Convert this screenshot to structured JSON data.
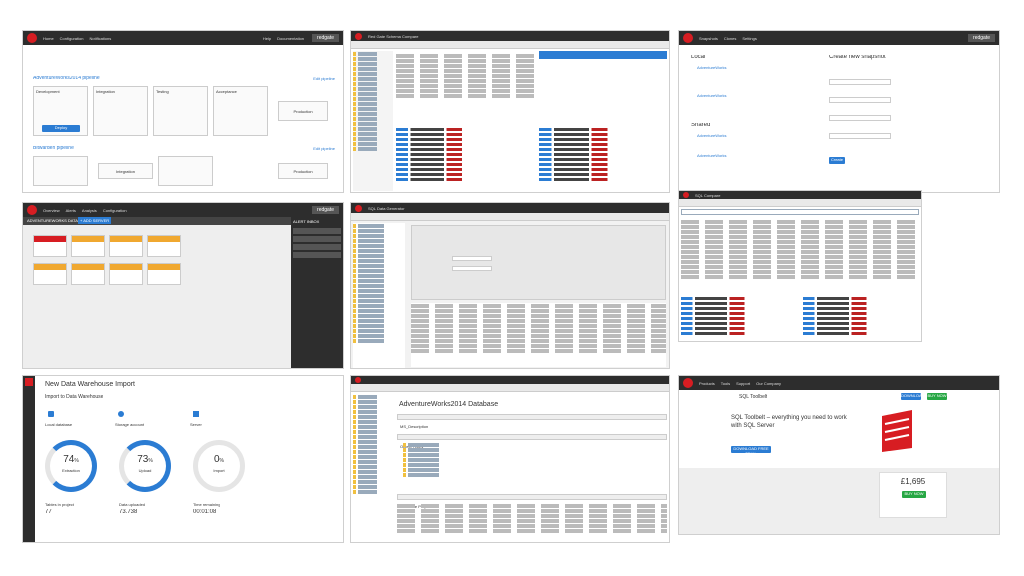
{
  "tiles": {
    "tile1": {
      "nav": [
        "Home",
        "Configuration",
        "Notifications"
      ],
      "header_right": [
        "Help",
        "Documentation"
      ],
      "brand": "redgate",
      "pipeline1_title": "AdventureWorks2014 pipeline",
      "pipeline2_title": "Bitwarden pipeline",
      "stages": [
        "Development",
        "Integration",
        "Testing",
        "Acceptance",
        "Production"
      ],
      "edit_link": "Edit pipeline",
      "deploy_label": "Deploy",
      "production_label": "Production",
      "integration_label": "Integration"
    },
    "tile2": {
      "tabs": [
        "Search",
        "Schema Compare"
      ],
      "title": "Red Gate Schema Compare",
      "brand": "redgate"
    },
    "tile3": {
      "nav": [
        "Snapshots",
        "Clones",
        "Settings"
      ],
      "brand": "redgate",
      "local_heading": "Local",
      "shared_heading": "Shared",
      "create_heading": "Create new snapshot",
      "snapshots": [
        "AdventureWorks",
        "AdventureWorks",
        "AdventureWorks",
        "AdventureWorks"
      ],
      "create_button": "Create"
    },
    "tile4": {
      "nav": [
        "Overview",
        "Alerts",
        "Analysis",
        "Configuration"
      ],
      "brand": "redgate",
      "group_label": "ADVENTUREWORKS DATABASES (6)",
      "alert_panel": "ALERT INBOX",
      "add_button": "+ ADD SERVER"
    },
    "tile5": {
      "title": "SQL Data Generator",
      "brand": "redgate"
    },
    "tile6": {
      "title": "SQL Compare",
      "brand": "redgate"
    },
    "tile7": {
      "title": "New Data Warehouse Import",
      "subtitle": "Import to Data Warehouse",
      "steps": [
        "Local database",
        "Storage account",
        "Server"
      ],
      "stat1_value": "74",
      "stat1_unit": "%",
      "stat1_label": "Extraction",
      "stat2_value": "73",
      "stat2_unit": "%",
      "stat2_label": "Upload",
      "stat3_value": "0",
      "stat3_unit": "%",
      "stat3_label": "Import",
      "footer1_label": "Tables in project",
      "footer1_value": "77",
      "footer2_label": "Data uploaded",
      "footer2_value": "73.738",
      "footer3_label": "Time remaining",
      "footer3_value": "00:01:08"
    },
    "tile8": {
      "title": "AdventureWorks2014 Database",
      "sections": [
        "MS_Description",
        "Object Types",
        "Database Properties"
      ],
      "props_cols": [
        "Property",
        "Value"
      ]
    },
    "tile9": {
      "nav": [
        "Products",
        "Tools",
        "Support",
        "Our Company"
      ],
      "brand": "redgate",
      "product_title": "SQL Toolbelt",
      "tagline_line1": "SQL Toolbelt – everything you need to work",
      "tagline_line2": "with SQL Server",
      "price": "£1,695",
      "buy_button": "BUY NOW",
      "download_button": "DOWNLOAD",
      "trial_button": "DOWNLOAD FREE TRIAL"
    }
  },
  "colors": {
    "accent_red": "#d71d22",
    "accent_blue": "#2b7cd3",
    "accent_green": "#27a744",
    "dark_bar": "#2d2d2d"
  }
}
